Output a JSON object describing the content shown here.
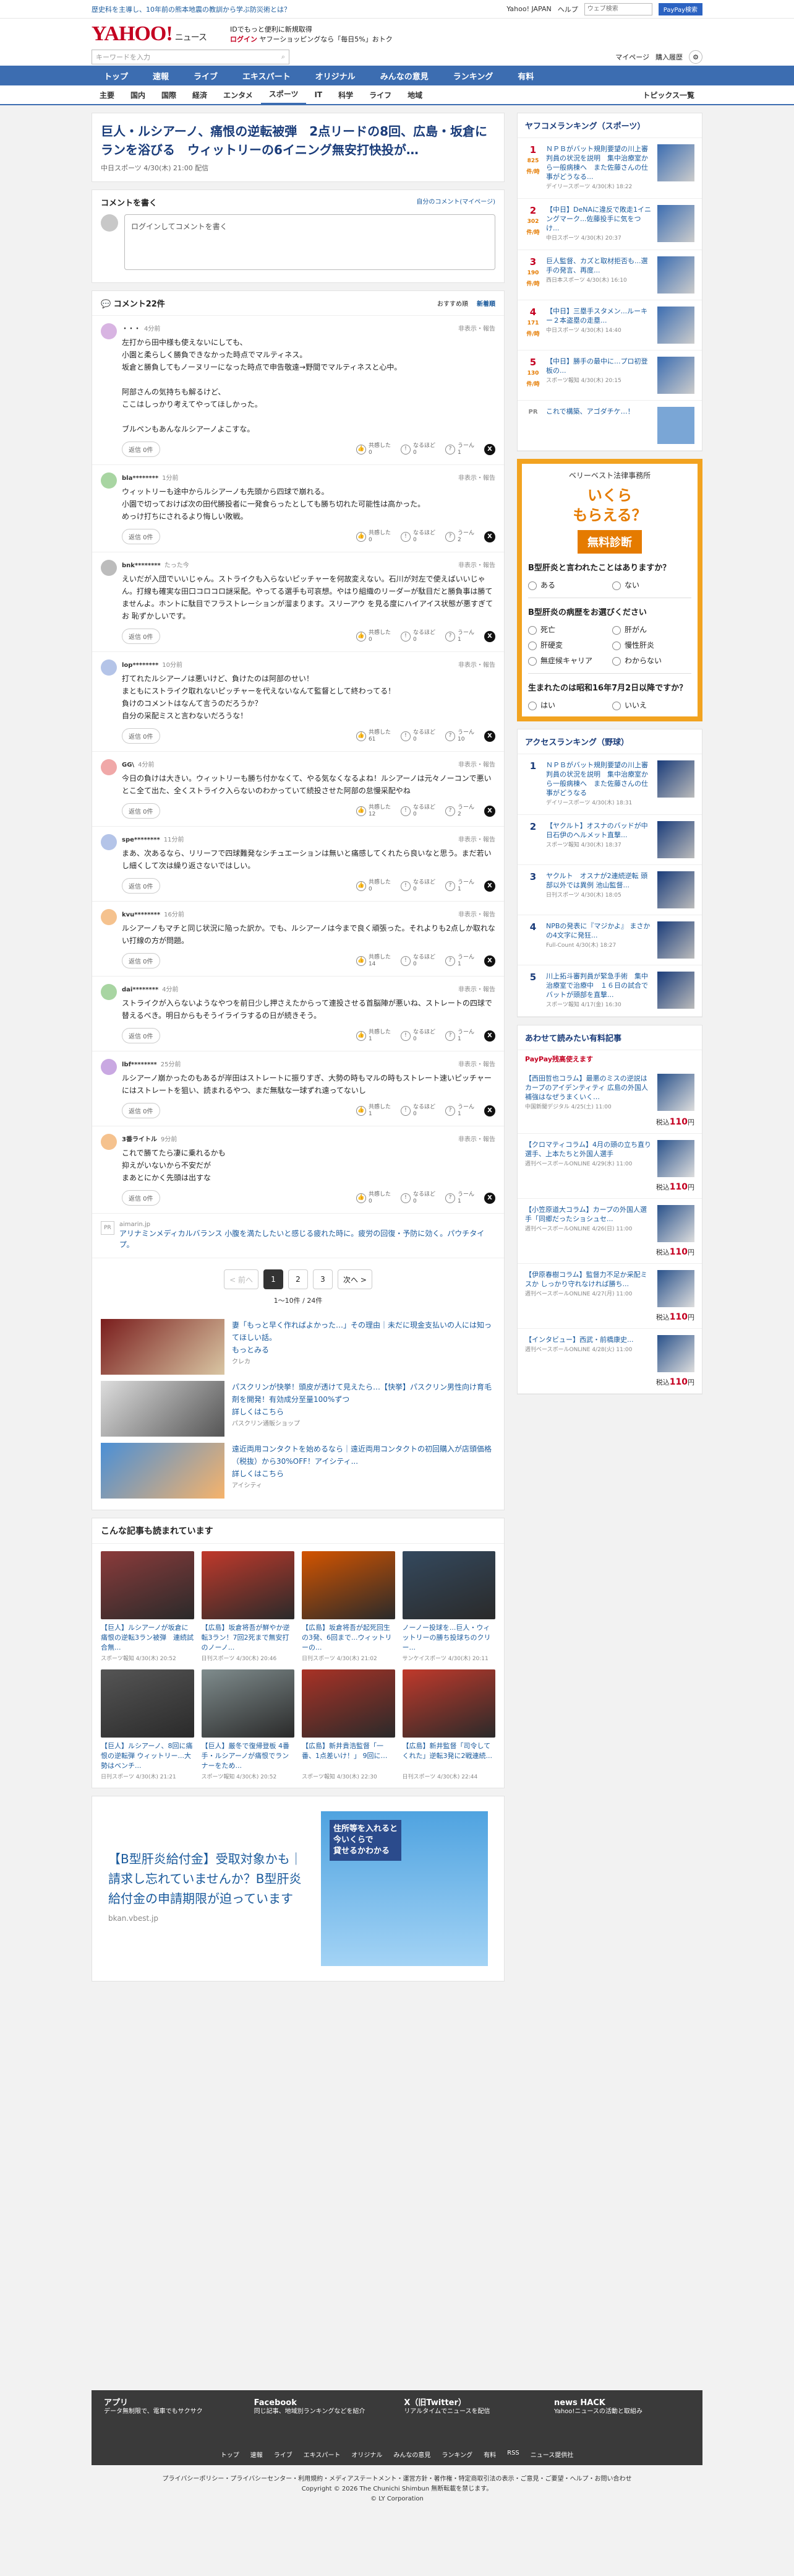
{
  "topbar": {
    "notice": "歴史科を主導し、10年前の熊本地震の教訓から学ぶ防災術とは？",
    "links": [
      "Yahoo! JAPAN",
      "ヘルプ"
    ],
    "search_placeholder": "ウェブ検索",
    "search_btn": "PayPay検索"
  },
  "header": {
    "logo": "YAHOO!",
    "logo_sub": "ニュース",
    "promo1": "IDでもっと便利に新規取得",
    "promo2": "ログイン",
    "promo3": "ヤフーショッピングなら「毎日5%」おトク",
    "search_placeholder": "キーワードを入力",
    "mynews": "マイページ",
    "login_btn": "購入履歴"
  },
  "nav1": [
    "トップ",
    "速報",
    "ライブ",
    "エキスパート",
    "オリジナル",
    "みんなの意見",
    "ランキング",
    "有料"
  ],
  "nav2": [
    "主要",
    "国内",
    "国際",
    "経済",
    "エンタメ",
    "スポーツ",
    "IT",
    "科学",
    "ライフ",
    "地域"
  ],
  "nav2_right": "トピックス一覧",
  "article": {
    "title": "巨人・ルシアーノ、痛恨の逆転被弾　2点リードの8回、広島・坂倉にランを浴びる　ウィットリーの6イニング無安打快投が…",
    "source": "中日スポーツ 4/30(木) 21:00 配信"
  },
  "post": {
    "title": "コメントを書く",
    "link": "自分のコメント(マイページ)",
    "placeholder": "ログインしてコメントを書く"
  },
  "comments_header": {
    "count": "コメント22件",
    "sort1": "おすすめ順",
    "sort2": "新着順"
  },
  "comments": [
    {
      "user": "・・・",
      "time": "4分前",
      "text": "左打から田中様も使えないにしても、\n小園と柔らしく勝負できなかった時点でマルティネス。\n坂倉と勝負してもノーヌリーになった時点で申告敬遠→野間でマルティネスと心中。\n\n阿部さんの気持ちも解るけど、\nここはしっかり考えてやってほしかった。\n\nブルペンもあんなルシアーノよこすな。",
      "a": "0",
      "b": "0",
      "c": "1"
    },
    {
      "user": "bla********",
      "time": "1分前",
      "text": "ウィットリーも途中からルシアーノも先頭から四球で崩れる。\n小園で切っておけば次の田代勝投者に一発食らったとしても勝ち切れた可能性は高かった。\nめっけ打ちにされるより悔しい敗戦。",
      "a": "0",
      "b": "0",
      "c": "2"
    },
    {
      "user": "bnk********",
      "time": "たった今",
      "text": "えいだが入団でいいじゃん。ストライクも入らないピッチャーを何故変えない。石川が対左で使えばいいじゃん。打線も確実な田口コロコロ謎采配。やってる選手も可哀想。やはり組織のリーダーが駄目だと勝負事は勝てませんよ。ホントに駄目でフラストレーションが溜まります。スリーアウ を見る度にハイアイス状態が悪すぎてお 恥ずかしいです。",
      "a": "0",
      "b": "0",
      "c": "1"
    },
    {
      "user": "lop********",
      "time": "10分前",
      "text": "打てれたルシアーノは悪いけど、負けたのは阿部のせい！\nまともにストライク取れないピッチャーを代えないなんて監督として終わってる！\n負けのコメントはなんて言うのだろうか？\n自分の采配ミスと言わないだろうな！",
      "a": "61",
      "b": "0",
      "c": "10"
    },
    {
      "user": "GG\\",
      "time": "4分前",
      "text": "今日の負けは大きい。ウィットリーも勝ち付かなくて、やる気なくなるよね！ルシアーノは元々ノーコンで悪いとこ全て出た、全くストライク入らないのわかっていて続投させた阿部の怠慢采配やね",
      "a": "12",
      "b": "0",
      "c": "2"
    },
    {
      "user": "spe********",
      "time": "11分前",
      "text": "まあ、次あるなら、リリーフで四球難発なシチュエーションは無いと痛感してくれたら良いなと思う。まだ若いし細くして次は繰り返さないではしい。",
      "a": "0",
      "b": "0",
      "c": "1"
    },
    {
      "user": "kvu********",
      "time": "16分前",
      "text": "ルシアーノもマチと同じ状況に陥った訳か。でも、ルシアーノは今まで良く頑張った。それよりも2点しか取れない打線の方が問題。",
      "a": "14",
      "b": "0",
      "c": "1"
    },
    {
      "user": "dai********",
      "time": "4分前",
      "text": "ストライクが入らないようなやつを前日少し押さえたからって連投させる首脳陣が悪いね、ストレートの四球で替えるべき。明日からもそうイライラするの日が続きそう。",
      "a": "1",
      "b": "0",
      "c": "1"
    },
    {
      "user": "lbf********",
      "time": "25分前",
      "text": "ルシアーノ崩かったのもあるが岸田はストレートに振りすぎ、大勢の時もマルの時もストレート速いピッチャーにはストレートを狙い、読まれるやつ、まだ無駄な一球ずれ遠ってないし",
      "a": "1",
      "b": "0",
      "c": "1"
    },
    {
      "user": "3番ライトル",
      "time": "9分前",
      "text": "これで勝てたら凄に乗れるかも\n抑えがいないから不安だが\nまあとにかく先頭は出すな",
      "a": "0",
      "b": "0",
      "c": "1"
    }
  ],
  "labels": {
    "reply": "返信 0件",
    "rate1": "共感した",
    "rate2": "なるほど",
    "rate3": "うーん",
    "report": "非表示・報告"
  },
  "pr_comment": {
    "source": "aimarin.jp",
    "text": "アリナミンメディカルバランス 小腹を満たしたいと感じる疲れた時に。疲労の回復・予防に効く。パウチタイプ。"
  },
  "pager": {
    "prev": "< 前へ",
    "pages": [
      "1",
      "2",
      "3"
    ],
    "next": "次へ >",
    "info": "1〜10件 / 24件"
  },
  "ads": [
    {
      "title": "妻「もっと早く作ればよかった…」その理由｜未だに現金支払いの人には知ってほしい話。",
      "sub": "もっとみる",
      "src": "クレカ"
    },
    {
      "title": "パスクリンが快挙！頭皮が透けて見えたら…【快挙】パスクリン男性向け育毛剤を開発！有効成分至量100%ずつ",
      "sub": "詳しくはこちら",
      "src": "パスクリン通販ショップ"
    },
    {
      "title": "遠近両用コンタクトを始めるなら｜遠近両用コンタクトの初回購入が店頭価格（税抜）から30%OFF！アイシティ...",
      "sub": "詳しくはこちら",
      "src": "アイシティ"
    }
  ],
  "related": {
    "title": "こんな記事も読まれています",
    "items": [
      {
        "t": "【巨人】ルシアーノが坂倉に痛恨の逆転3ラン被弾　連続試合無...",
        "s": "スポーツ報知 4/30(木) 20:52"
      },
      {
        "t": "【広島】坂倉将吾が鮮やか逆転3ラン！7回2死まで無安打のノーノ...",
        "s": "日刊スポーツ 4/30(木) 20:46"
      },
      {
        "t": "【広島】坂倉将吾が起死回生の3発、6回まで...ウィットリーの...",
        "s": "日刊スポーツ 4/30(木) 21:02"
      },
      {
        "t": "ノーノー投球を...巨人・ウィットリーの勝ち投球ちのクリー...",
        "s": "サンケイスポーツ 4/30(木) 20:11"
      },
      {
        "t": "【巨人】ルシアーノ、8回に痛恨の逆転弾 ウィットリー...大勢はベンチ...",
        "s": "日刊スポーツ 4/30(木) 21:21"
      },
      {
        "t": "【巨人】厳冬で復帰登板 4番手・ルシアーノが痛恨でランナーをため...",
        "s": "スポーツ報知 4/30(木) 20:52"
      },
      {
        "t": "【広島】新井貴浩監督「一番、1点差いけ！」  9回に…",
        "s": "スポーツ報知 4/30(木) 22:30"
      },
      {
        "t": "【広島】新井監督「司令してくれた」逆転3発に2戦連続...",
        "s": "日刊スポーツ 4/30(木) 22:44"
      }
    ]
  },
  "bigad": {
    "title": "【B型肝炎給付金】受取対象かも｜請求し忘れていませんか？B型肝炎給付金の申請期限が迫っています",
    "src": "bkan.vbest.jp",
    "band": "住所等を入れると\n今いくらで\n貸せるかわかる"
  },
  "side_rank": {
    "title": "ヤフコメランキング（スポーツ）",
    "items": [
      {
        "n": "1",
        "c": "825件/時",
        "t": "ＮＰＢがバット規則要望の川上審判員の状況を説明　集中治療室から一般病棟へ　また佐藤さんの仕事がどうなる...",
        "s": "デイリースポーツ 4/30(木) 18:22"
      },
      {
        "n": "2",
        "c": "302件/時",
        "t": "【中日】DeNAに違反で敗走1イニングマーク...佐藤投手に気をつけ...",
        "s": "中日スポーツ 4/30(木) 20:37"
      },
      {
        "n": "3",
        "c": "190件/時",
        "t": "巨人監督、カズと取材拒否も...選手の発言、再度...",
        "s": "西日本スポーツ 4/30(木) 16:10"
      },
      {
        "n": "4",
        "c": "171件/時",
        "t": "【中日】三塁手スタメン...ルーキー２本盗塁の走塁...",
        "s": "中日スポーツ 4/30(木) 14:40"
      },
      {
        "n": "5",
        "c": "130件/時",
        "t": "【中日】勝手の最中に...プロ初登板の...",
        "s": "スポーツ報知 4/30(木) 20:15"
      }
    ],
    "pr": "これで構築、アゴダチケ…！"
  },
  "diag": {
    "brand": "ベリーベスト法律事務所",
    "big1": "いくら",
    "big2": "もらえる？",
    "btn": "無料診断",
    "q1": "B型肝炎と言われたことはありますか？",
    "q1o": [
      "ある",
      "ない"
    ],
    "q2": "B型肝炎の病歴をお選びください",
    "q2o": [
      "死亡",
      "肝がん",
      "肝硬変",
      "慢性肝炎",
      "無症候キャリア",
      "わからない"
    ],
    "q3": "生まれたのは昭和16年7月2日以降ですか？",
    "q3o": [
      "はい",
      "いいえ"
    ]
  },
  "side_access": {
    "title": "アクセスランキング（野球）",
    "items": [
      {
        "n": "1",
        "t": "ＮＰＢがバット規則要望の川上審判員の状況を説明　集中治療室から一般病棟へ　また佐藤さんの仕事がどうなる",
        "s": "デイリースポーツ 4/30(木) 18:31"
      },
      {
        "n": "2",
        "t": "【ヤクルト】オスナのバッドが中日石伊のヘルメット直撃...",
        "s": "スポーツ報知 4/30(木) 18:37"
      },
      {
        "n": "3",
        "t": "ヤクルト　オスナが2連続逆転 頭部以外では異例 池山監督...",
        "s": "日刊スポーツ 4/30(木) 18:05"
      },
      {
        "n": "4",
        "t": "NPBの発表に『マジかよ』 まさかの4文字に発狂...",
        "s": "Full-Count 4/30(木) 18:27"
      },
      {
        "n": "5",
        "t": "川上拓斗審判員が緊急手術　集中治療室で治療中　１６日の試合でバットが頭部を直撃...",
        "s": "スポーツ報知 4/17(金) 16:30"
      }
    ]
  },
  "side_paid": {
    "title": "あわせて読みたい有料記事",
    "items": [
      {
        "t": "【西田哲也コラム】最悪のミスの逆説はカープのアイデンティティ 広島の外国人補強はなぜうまくいく…",
        "s": "中国新聞デジタル 4/25(土) 11:00",
        "p": "110"
      },
      {
        "t": "【クロマティコラム】4月の頭の立ち直り選手、上本たちと外国人選手",
        "s": "週刊ベースボールONLINE 4/29(水) 11:00",
        "p": "110"
      },
      {
        "t": "【小笠原道大コラム】カープの外国人選手「同郷だったショシュセ...",
        "s": "週刊ベースボールONLINE 4/26(日) 11:00",
        "p": "110"
      },
      {
        "t": "【伊原春樹コラム】監督力不足か采配ミスか しっかり守れなければ勝ち...",
        "s": "週刊ベースボールONLINE 4/27(月) 11:00",
        "p": "110"
      },
      {
        "t": "【インタビュー】西武・前橋康史...",
        "s": "週刊ベースボールONLINE 4/28(火) 11:00",
        "p": "110"
      }
    ]
  },
  "footer": {
    "apps": [
      {
        "t": "アプリ",
        "d": "データ無制限で、電車でもサクサク"
      },
      {
        "t": "Facebook",
        "d": "同じ記事、地域別ランキングなどを紹介"
      },
      {
        "t": "X（旧Twitter）",
        "d": "リアルタイムでニュースを配信"
      },
      {
        "t": "news HACK",
        "d": "Yahoo!ニュースの活動と取組み"
      }
    ],
    "links": [
      "トップ",
      "速報",
      "ライブ",
      "エキスパート",
      "オリジナル",
      "みんなの意見",
      "ランキング",
      "有料",
      "RSS",
      "ニュース提供社"
    ],
    "copy1": "プライバシーポリシー・プライバシーセンター・利用規約・メディアステートメント・運営方針・著作権・特定商取引法の表示・ご意見・ご要望・ヘルプ・お問い合わせ",
    "copy2": "Copyright © 2026 The Chunichi Shimbun 無断転載を禁じます。",
    "copy3": "© LY Corporation"
  }
}
